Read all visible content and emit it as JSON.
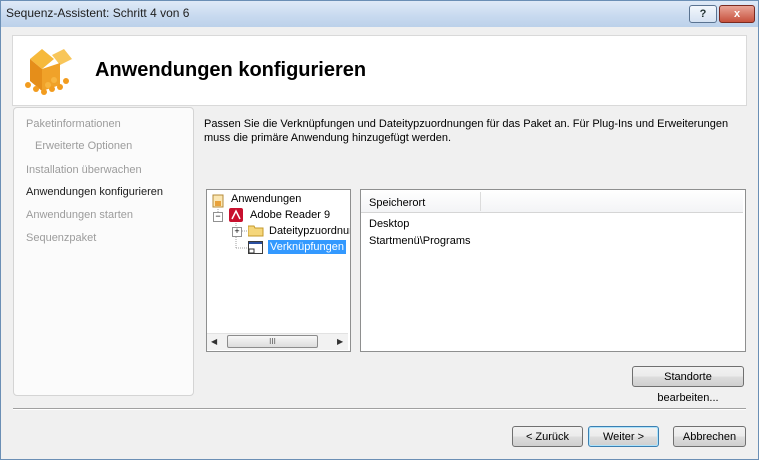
{
  "window": {
    "title": "Sequenz-Assistent: Schritt 4 von 6",
    "help_label": "?",
    "close_label": "x"
  },
  "header": {
    "title": "Anwendungen konfigurieren"
  },
  "nav": {
    "items": [
      {
        "label": "Paketinformationen",
        "state": "disabled"
      },
      {
        "label": "Erweiterte Optionen",
        "state": "disabled"
      },
      {
        "label": "Installation überwachen",
        "state": "disabled"
      },
      {
        "label": "Anwendungen konfigurieren",
        "state": "current"
      },
      {
        "label": "Anwendungen starten",
        "state": "disabled"
      },
      {
        "label": "Sequenzpaket",
        "state": "disabled"
      }
    ]
  },
  "description": "Passen Sie die Verknüpfungen und Dateitypzuordnungen für das Paket an. Für Plug-Ins und Erweiterungen muss die primäre Anwendung hinzugefügt werden.",
  "tree": {
    "root": "Anwendungen",
    "app": "Adobe Reader 9",
    "child1": "Dateitypzuordnun",
    "child2": "Verknüpfungen",
    "scroll_thumb": "III"
  },
  "list": {
    "column_header": "Speicherort",
    "rows": [
      "Desktop",
      "Startmenü\\Programs"
    ]
  },
  "buttons": {
    "edit_locations": "Standorte bearbeiten...",
    "back": "< Zurück",
    "next": "Weiter >",
    "cancel": "Abbrechen"
  },
  "colors": {
    "selection": "#3399ff",
    "header_bg": "#ffffff",
    "window_bg": "#f0f0f0"
  }
}
